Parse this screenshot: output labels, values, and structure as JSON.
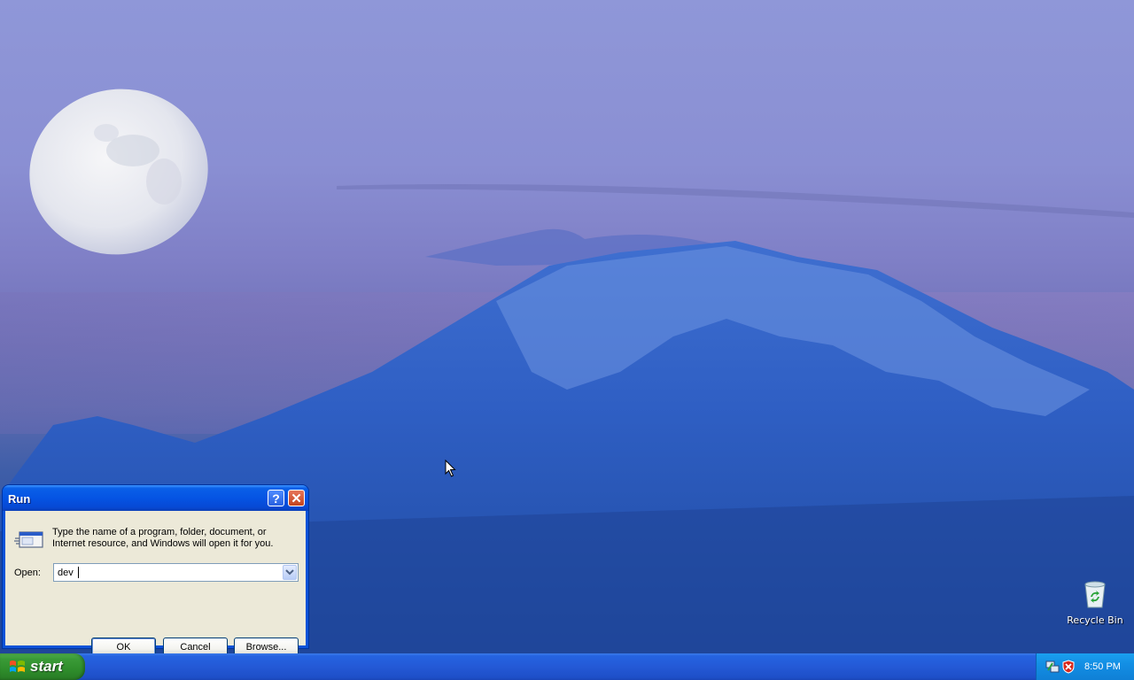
{
  "desktop": {
    "icons": [
      {
        "label": "Recycle Bin",
        "icon": "recycle-bin-icon"
      }
    ]
  },
  "run_dialog": {
    "title": "Run",
    "description": "Type the name of a program, folder, document, or Internet resource, and Windows will open it for you.",
    "open_label": "Open:",
    "open_value": "dev",
    "ok_label": "OK",
    "cancel_label": "Cancel",
    "browse_label": "Browse...",
    "help_glyph": "?",
    "close_glyph": "✕"
  },
  "taskbar": {
    "start_label": "start",
    "clock": "8:50 PM"
  },
  "colors": {
    "title_bar": "#0554e3",
    "dialog_body": "#ece9d8",
    "taskbar": "#245edb",
    "start_button": "#3a9b37",
    "tray": "#138ee4"
  }
}
